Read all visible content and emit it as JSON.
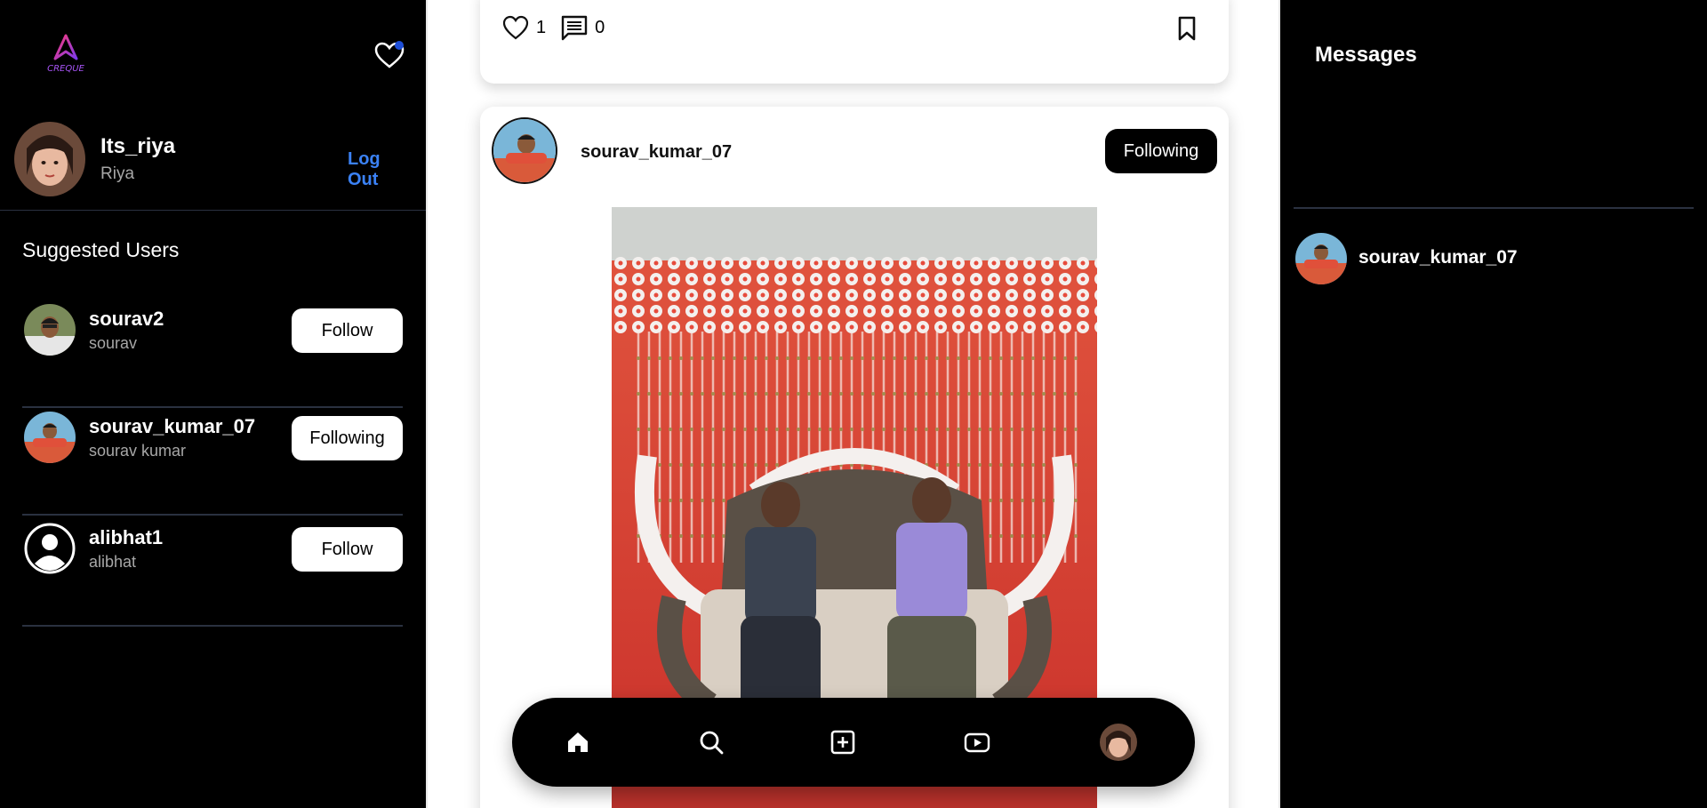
{
  "app": {
    "brand": "CREQUE"
  },
  "current_user": {
    "username": "Its_riya",
    "name": "Riya",
    "logout_label": "Log Out"
  },
  "suggested": {
    "title": "Suggested Users",
    "users": [
      {
        "username": "sourav2",
        "name": "sourav",
        "button": "Follow"
      },
      {
        "username": "sourav_kumar_07",
        "name": "sourav kumar",
        "button": "Following"
      },
      {
        "username": "alibhat1",
        "name": "alibhat",
        "button": "Follow"
      }
    ]
  },
  "feed": {
    "prev_post": {
      "likes": "1",
      "comments": "0"
    },
    "post": {
      "username": "sourav_kumar_07",
      "follow_label": "Following"
    }
  },
  "bottom_nav": {
    "items": [
      "home-icon",
      "search-icon",
      "create-icon",
      "reels-icon",
      "profile-avatar"
    ]
  },
  "messages": {
    "title": "Messages",
    "chats": [
      {
        "username": "sourav_kumar_07"
      }
    ]
  },
  "colors": {
    "accent": "#3b82f6",
    "notification_dot": "#1d4ed8",
    "sidebar_bg": "#000000"
  }
}
